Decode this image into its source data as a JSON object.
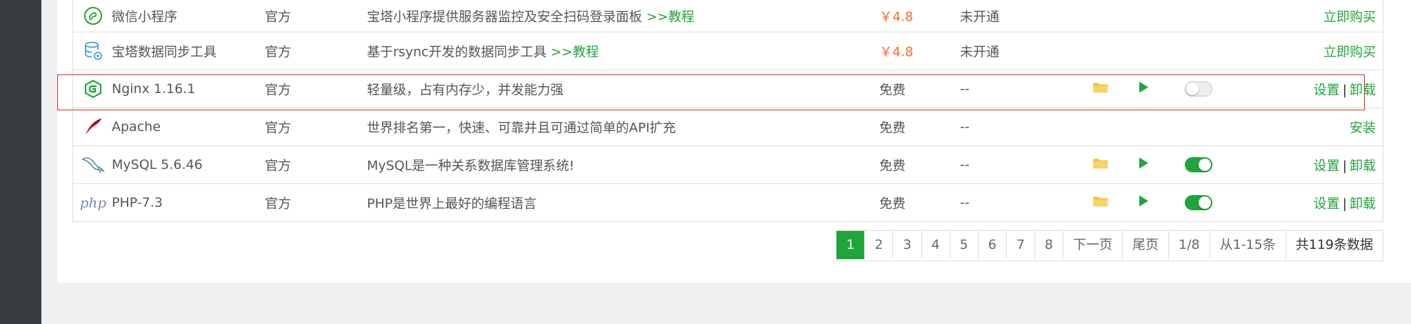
{
  "colors": {
    "accent": "#20a53a",
    "price": "#fc6d26",
    "sidebar": "#393d42",
    "highlight": "#e02020"
  },
  "rows": [
    {
      "icon": "wechat-mini-program-icon",
      "name": "微信小程序",
      "type": "官方",
      "desc": "宝塔小程序提供服务器监控及安全扫码登录面板",
      "desc_link": ">>教程",
      "price": "￥4.8",
      "status": "未开通",
      "ops": [
        "立即购买"
      ]
    },
    {
      "icon": "database-sync-icon",
      "name": "宝塔数据同步工具",
      "type": "官方",
      "desc": "基于rsync开发的数据同步工具",
      "desc_link": ">>教程",
      "price": "￥4.8",
      "status": "未开通",
      "ops": [
        "立即购买"
      ]
    },
    {
      "icon": "nginx-icon",
      "name": "Nginx 1.16.1",
      "type": "官方",
      "desc": "轻量级，占有内存少，并发能力强",
      "price": "免费",
      "status": "--",
      "toggle": "off",
      "ops": [
        "设置",
        "卸载"
      ]
    },
    {
      "icon": "apache-feather-icon",
      "name": "Apache",
      "type": "官方",
      "desc": "世界排名第一，快速、可靠并且可通过简单的API扩充",
      "price": "免费",
      "status": "--",
      "ops": [
        "安装"
      ]
    },
    {
      "icon": "mysql-dolphin-icon",
      "name": "MySQL 5.6.46",
      "type": "官方",
      "desc": "MySQL是一种关系数据库管理系统!",
      "price": "免费",
      "status": "--",
      "toggle": "on",
      "ops": [
        "设置",
        "卸载"
      ]
    },
    {
      "icon": "php-icon",
      "icon_text": "php",
      "name": "PHP-7.3",
      "type": "官方",
      "desc": "PHP是世界上最好的编程语言",
      "price": "免费",
      "status": "--",
      "toggle": "on",
      "ops": [
        "设置",
        "卸载"
      ]
    }
  ],
  "pagination": {
    "pages": [
      "1",
      "2",
      "3",
      "4",
      "5",
      "6",
      "7",
      "8"
    ],
    "current": "1",
    "next": "下一页",
    "last": "尾页",
    "page_of": "1/8",
    "range": "从1-15条",
    "total": "共119条数据"
  }
}
